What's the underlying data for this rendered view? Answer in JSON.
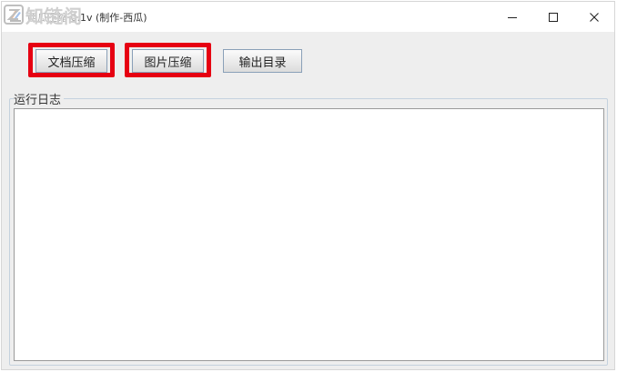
{
  "window": {
    "title": "西瓜压缩 0.1v (制作-西瓜)",
    "controls": {
      "minimize": "—",
      "maximize": "☐",
      "close": "✕"
    }
  },
  "watermark": {
    "text": "知链阁"
  },
  "toolbar": {
    "doc_compress_label": "文档压缩",
    "img_compress_label": "图片压缩",
    "output_dir_label": "输出目录"
  },
  "log": {
    "label": "运行日志",
    "content": ""
  },
  "colors": {
    "window_bg": "#eeeeee",
    "highlight": "#e60012",
    "button_border": "#8aa0b8"
  },
  "icons": [
    "app-icon",
    "minimize-icon",
    "maximize-icon",
    "close-icon"
  ]
}
